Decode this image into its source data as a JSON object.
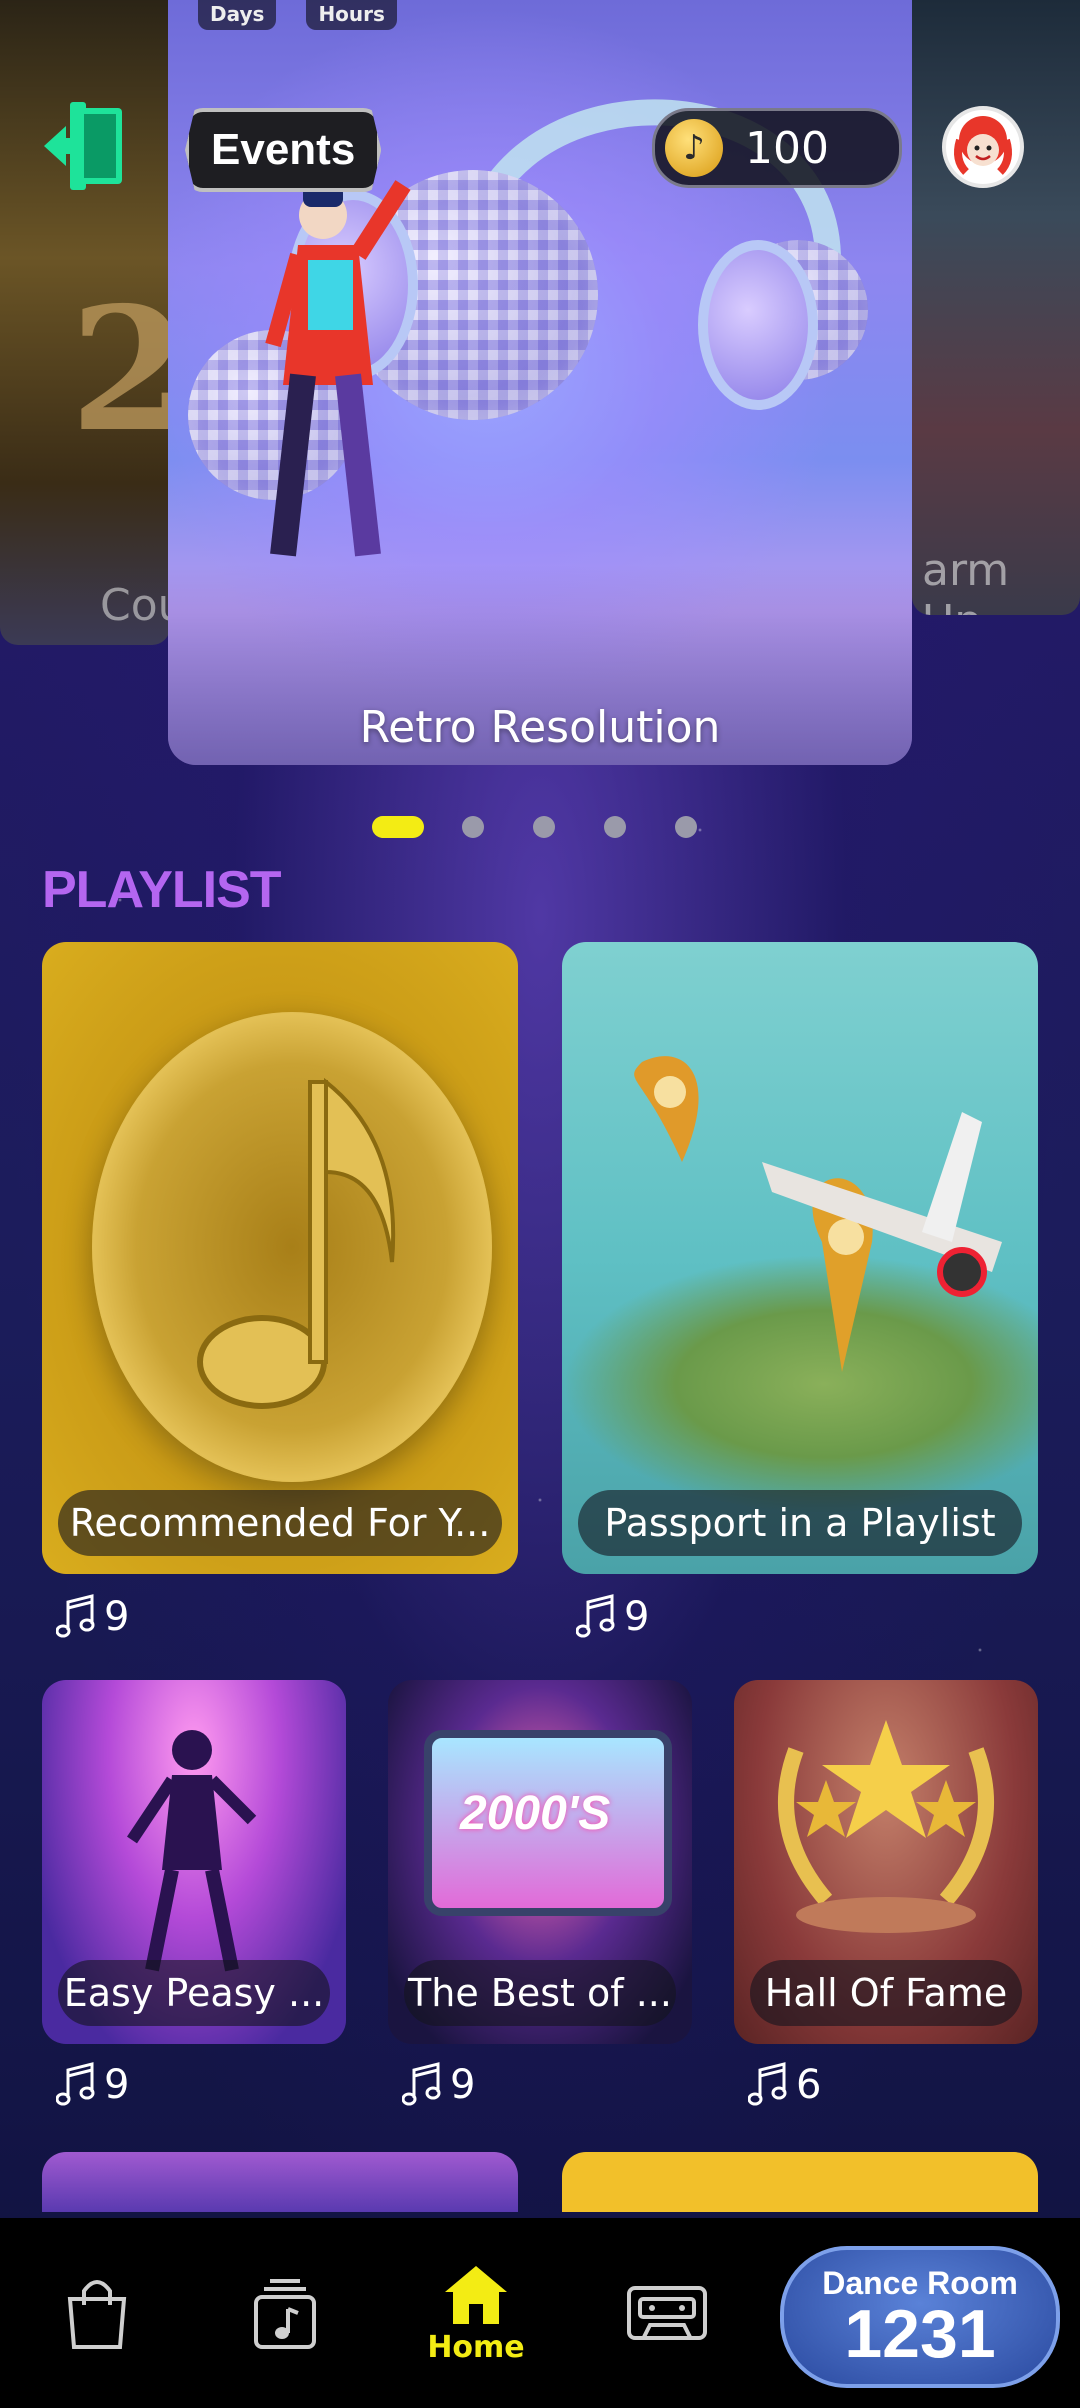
{
  "carousel": {
    "countdown": {
      "days_label": "Days",
      "hours_label": "Hours"
    },
    "left_card_label": "Cou",
    "right_card_label": "arm Up",
    "hero_title": "Retro Resolution",
    "pages": 5,
    "active_page": 1
  },
  "header": {
    "events_label": "Events",
    "coins": "100"
  },
  "section": {
    "title": "PLAYLIST"
  },
  "playlists": [
    {
      "title": "Recommended For Y...",
      "count": "9"
    },
    {
      "title": "Passport in a Playlist",
      "count": "9"
    },
    {
      "title": "Easy Peasy ...",
      "count": "9"
    },
    {
      "title": "The Best of ...",
      "count": "9"
    },
    {
      "title": "Hall Of Fame",
      "count": "6"
    }
  ],
  "tv_text": "2000'S",
  "nav": {
    "home_label": "Home",
    "dance_room_label": "Dance Room",
    "dance_room_number": "1231"
  },
  "colors": {
    "accent_yellow": "#f3ec14",
    "section_purple": "#b466f0",
    "logout_green": "#1ee39a"
  }
}
